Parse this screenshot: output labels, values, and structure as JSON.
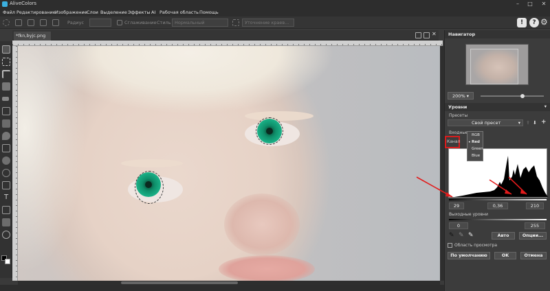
{
  "app": {
    "title": "AliveColors"
  },
  "menu": [
    "Файл",
    "Редактирование",
    "Изображение",
    "Слои",
    "Выделение",
    "Эффекты",
    "AI",
    "Рабочая область",
    "Помощь"
  ],
  "options": {
    "radius_label": "Радиус",
    "smoothing_label": "Сглаживание",
    "style_label": "Стиль",
    "style_value": "Нормальный",
    "refine_label": "Уточнение краев..."
  },
  "document": {
    "tab_title": "*fkn,byjc.png"
  },
  "navigator": {
    "title": "Навигатор",
    "zoom": "200%"
  },
  "levels": {
    "title": "Уровни",
    "presets_label": "Пресеты",
    "preset_value": "Свой пресет",
    "input_label": "Входные",
    "channel_label": "Канал",
    "channels": [
      "RGB",
      "Red",
      "Green",
      "Blue"
    ],
    "selected_channel": "Red",
    "input_black": "29",
    "input_gamma": "0,36",
    "input_white": "210",
    "output_label": "Выходные уровни",
    "output_black": "0",
    "output_white": "255",
    "auto_label": "Авто",
    "options_label": "Опции...",
    "preview_label": "Область просмотра",
    "default_label": "По умолчанию",
    "ok_label": "OK",
    "cancel_label": "Отмена"
  }
}
